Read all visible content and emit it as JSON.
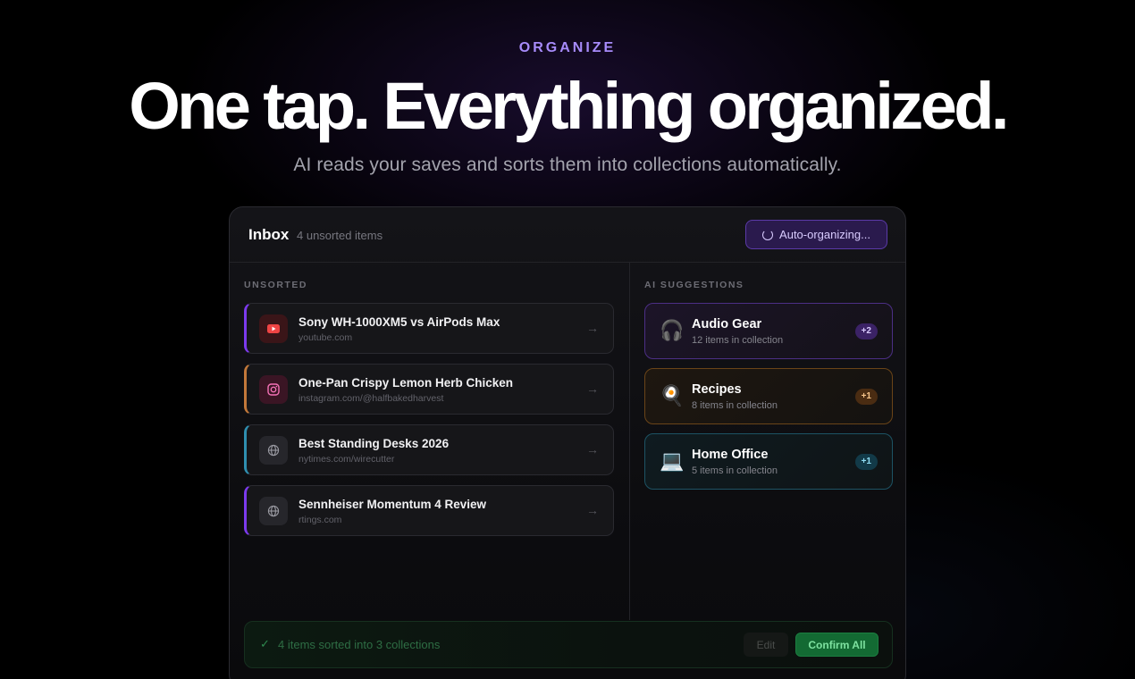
{
  "hero": {
    "eyebrow": "ORGANIZE",
    "headline": "One tap. Everything organized.",
    "subhead": "AI reads your saves and sorts them into collections automatically."
  },
  "inbox": {
    "title": "Inbox",
    "count_label": "4 unsorted items",
    "auto_button_label": "Auto-organizing..."
  },
  "unsorted": {
    "section_label": "UNSORTED",
    "items": [
      {
        "title": "Sony WH-1000XM5 vs AirPods Max",
        "url": "youtube.com",
        "source_icon": "youtube-icon",
        "accent": "#7c3aed"
      },
      {
        "title": "One-Pan Crispy Lemon Herb Chicken",
        "url": "instagram.com/@halfbakedharvest",
        "source_icon": "instagram-icon",
        "accent": "#c2783a"
      },
      {
        "title": "Best Standing Desks 2026",
        "url": "nytimes.com/wirecutter",
        "source_icon": "globe-icon",
        "accent": "#2f8fb0"
      },
      {
        "title": "Sennheiser Momentum 4 Review",
        "url": "rtings.com",
        "source_icon": "globe-icon",
        "accent": "#7c3aed"
      }
    ]
  },
  "suggestions": {
    "section_label": "AI SUGGESTIONS",
    "items": [
      {
        "emoji": "🎧",
        "title": "Audio Gear",
        "subtitle": "12 items in collection",
        "badge": "+2",
        "color": "#8b5cf6"
      },
      {
        "emoji": "🍳",
        "title": "Recipes",
        "subtitle": "8 items in collection",
        "badge": "+1",
        "color": "#d97706"
      },
      {
        "emoji": "💻",
        "title": "Home Office",
        "subtitle": "5 items in collection",
        "badge": "+1",
        "color": "#0ea5c9"
      }
    ]
  },
  "footer": {
    "status": "4 items sorted into 3 collections",
    "edit_label": "Edit",
    "confirm_label": "Confirm All"
  }
}
